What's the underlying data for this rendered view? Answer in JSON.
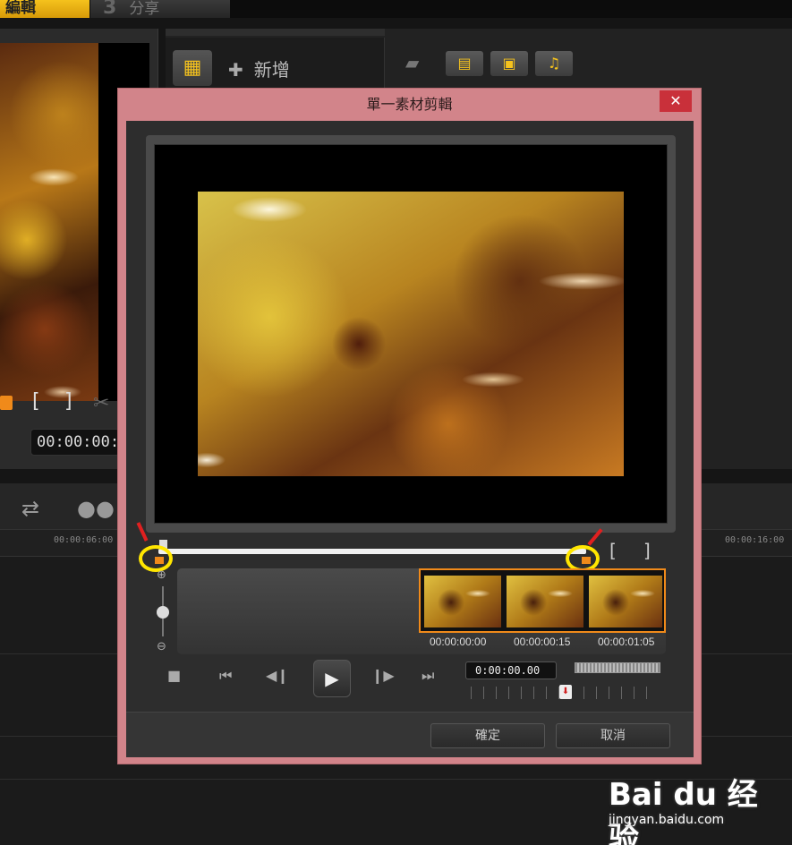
{
  "tabs": {
    "edit_label": "編輯",
    "share_num": "3",
    "share_label": "分享"
  },
  "player": {
    "timecode": "00:00:00:0",
    "mark_in": "[",
    "mark_out": "]",
    "scissors_icon": "scissors-icon"
  },
  "library": {
    "add_label": "新增",
    "filters": [
      "video-filter-icon",
      "photo-filter-icon",
      "music-filter-icon"
    ]
  },
  "timeline": {
    "ruler_times": [
      "00:00:06:00",
      "00:00:16:00"
    ]
  },
  "dialog": {
    "title": "單一素材剪輯",
    "close_label": "✕",
    "mark_in_label": "[",
    "mark_out_label": "]",
    "frames": [
      {
        "time": "00:00:00:00"
      },
      {
        "time": "00:00:00:15"
      },
      {
        "time": "00:00:01:05"
      }
    ],
    "timecode": "0:00:00.00",
    "ok_label": "確定",
    "cancel_label": "取消"
  },
  "watermark": {
    "logo": "Bai du 经验",
    "url": "jingyan.baidu.com"
  },
  "colors": {
    "accent": "#f5c21d",
    "dialog_frame": "#d2848a",
    "close_button": "#c9303a",
    "trim_marker": "#f08a1a",
    "highlight": "#ffe600"
  }
}
